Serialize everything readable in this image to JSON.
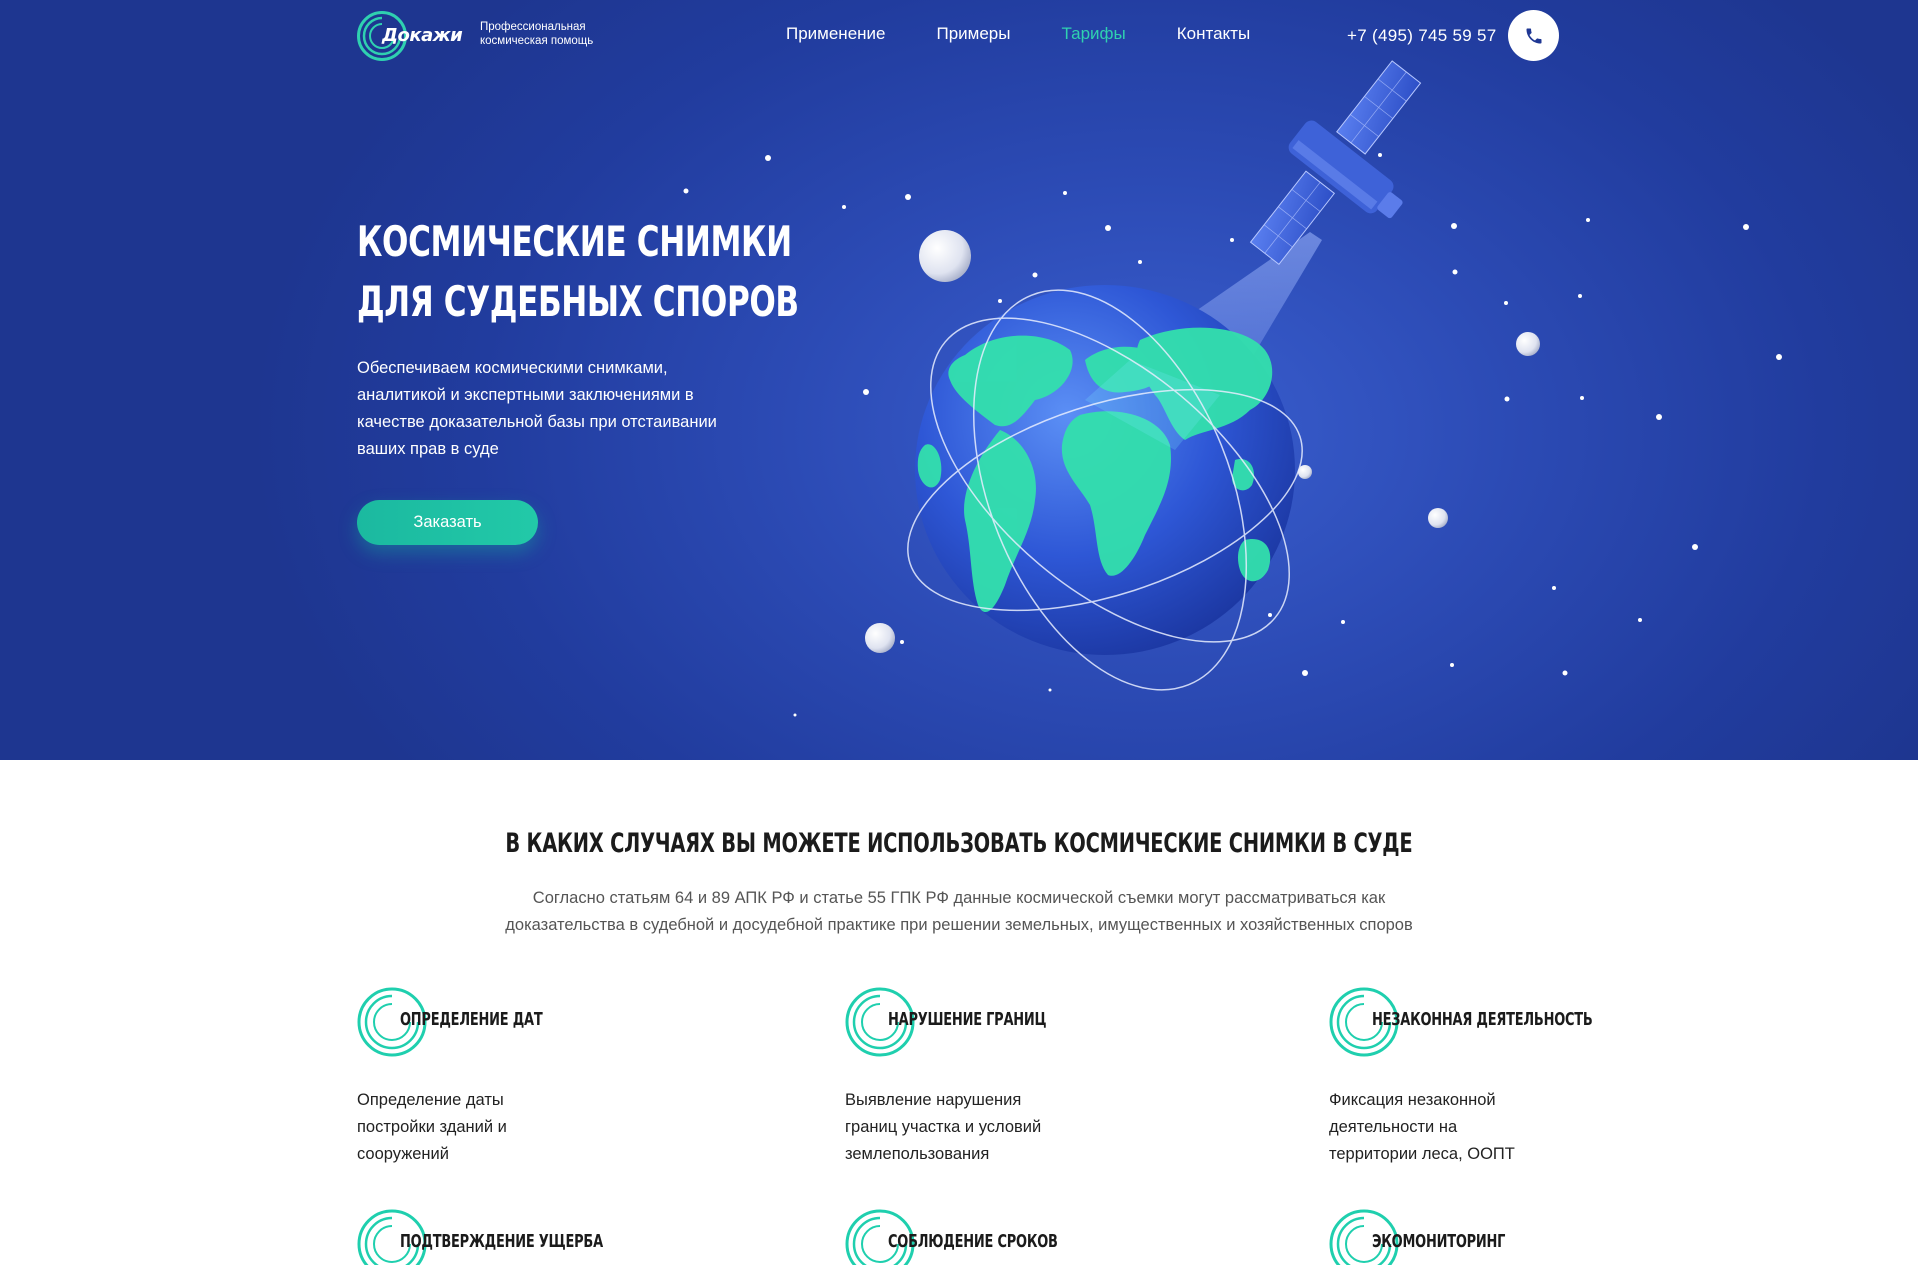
{
  "brand": {
    "name": "Докажи",
    "tagline": "Профессиональная космическая помощь"
  },
  "nav": {
    "items": [
      {
        "label": "Применение",
        "active": false
      },
      {
        "label": "Примеры",
        "active": false
      },
      {
        "label": "Тарифы",
        "active": true
      },
      {
        "label": "Контакты",
        "active": false
      }
    ]
  },
  "contact": {
    "phone": "+7 (495) 745 59 57",
    "call_icon": "phone-icon"
  },
  "hero": {
    "title_line1": "Космические снимки",
    "title_line2": "для судебных споров",
    "text": "Обеспечиваем космическими снимками, аналитикой и экспертными заключениями в качестве доказательной базы при отстаивании ваших прав в суде",
    "cta": "Заказать"
  },
  "usage": {
    "title": "В каких случаях вы можете использовать космические снимки в суде",
    "subtitle_line1": "Согласно статьям 64 и 89 АПК РФ и статье 55 ГПК РФ данные космической съемки могут рассматриваться как",
    "subtitle_line2": "доказательства в судебной и досудебной практике при решении земельных, имущественных и хозяйственных споров",
    "cards": [
      {
        "title": "Определение дат",
        "desc": "Определение даты постройки зданий и сооружений"
      },
      {
        "title": "Нарушение границ",
        "desc": "Выявление нарушения границ участка и условий землепользования"
      },
      {
        "title": "Незаконная деятельность",
        "desc": "Фиксация незаконной деятельности на территории леса, ООПТ"
      },
      {
        "title": "Подтверждение ущерба",
        "desc": ""
      },
      {
        "title": "Соблюдение сроков",
        "desc": ""
      },
      {
        "title": "Экомониторинг",
        "desc": ""
      }
    ]
  },
  "colors": {
    "hero_bg": "#213c9e",
    "accent": "#2fd1b0",
    "button": "#1bb9a0"
  }
}
